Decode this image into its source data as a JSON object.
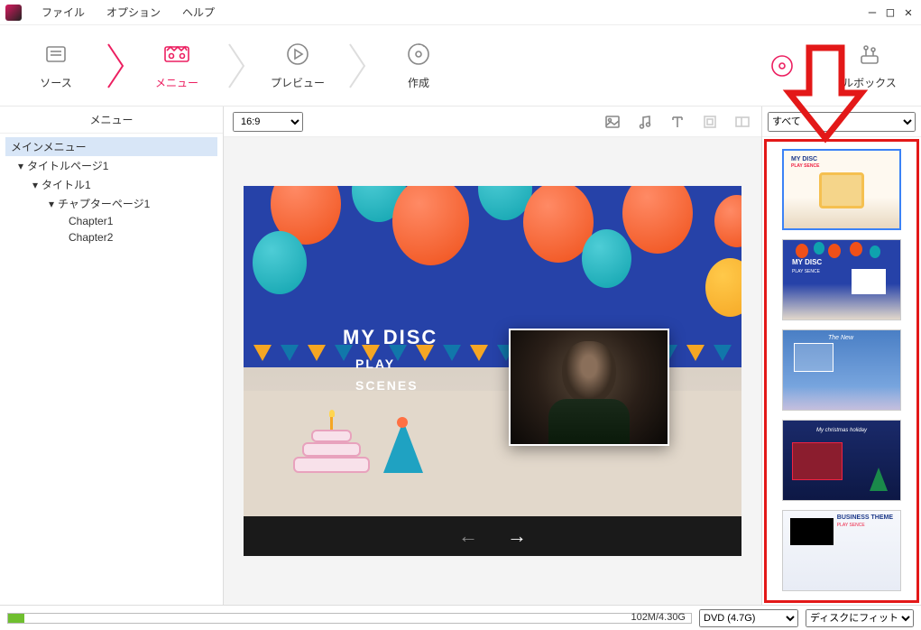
{
  "menubar": {
    "items": [
      "ファイル",
      "オプション",
      "ヘルプ"
    ]
  },
  "toolbar": {
    "steps": [
      {
        "label": "ソース"
      },
      {
        "label": "メニュー"
      },
      {
        "label": "プレビュー"
      },
      {
        "label": "作成"
      }
    ],
    "toolbox_label": "ルボックス"
  },
  "sidebar": {
    "header": "メニュー",
    "tree": {
      "root": "メインメニュー",
      "items": [
        "タイトルページ1",
        "タイトル1",
        "チャプターページ1",
        "Chapter1",
        "Chapter2"
      ]
    }
  },
  "center": {
    "aspect": "16:9",
    "disc_title": "MY DISC",
    "disc_play": "PLAY",
    "disc_scenes": "SCENES"
  },
  "templates": {
    "filter": "すべて",
    "items": [
      {
        "title": "MY DISC",
        "sub": "PLAY SENCE"
      },
      {
        "title": "MY DISC",
        "sub": "PLAY SENCE"
      },
      {
        "title": "The New"
      },
      {
        "title": "My christmas holiday"
      },
      {
        "title": "BUSINESS THEME",
        "sub": "PLAY SENCE"
      }
    ]
  },
  "statusbar": {
    "usage": "102M/4.30G",
    "disc_type": "DVD (4.7G)",
    "fit": "ディスクにフィット"
  }
}
